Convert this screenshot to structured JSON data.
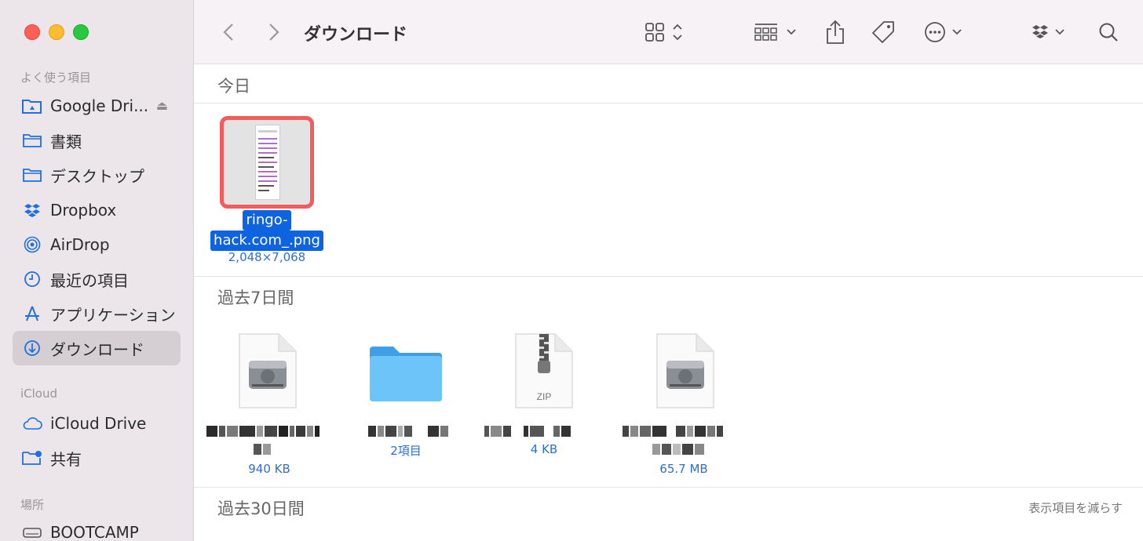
{
  "window": {
    "title": "ダウンロード"
  },
  "sidebar": {
    "favorites_header": "よく使う項目",
    "favorites": [
      {
        "label": "Google Dri...",
        "icon": "google-drive-folder-icon"
      },
      {
        "label": "書類",
        "icon": "folder-icon"
      },
      {
        "label": "デスクトップ",
        "icon": "folder-icon"
      },
      {
        "label": "Dropbox",
        "icon": "dropbox-icon"
      },
      {
        "label": "AirDrop",
        "icon": "airdrop-icon"
      },
      {
        "label": "最近の項目",
        "icon": "clock-icon"
      },
      {
        "label": "アプリケーション",
        "icon": "applications-icon"
      },
      {
        "label": "ダウンロード",
        "icon": "download-icon",
        "active": true
      }
    ],
    "icloud_header": "iCloud",
    "icloud": [
      {
        "label": "iCloud Drive",
        "icon": "cloud-icon"
      },
      {
        "label": "共有",
        "icon": "shared-folder-icon"
      }
    ],
    "locations_header": "場所",
    "locations": [
      {
        "label": "BOOTCAMP",
        "icon": "disk-icon"
      }
    ]
  },
  "groups": {
    "today": "今日",
    "last7": "過去7日間",
    "last30": "過去30日間",
    "show_less": "表示項目を減らす"
  },
  "selected_file": {
    "name_line1": "ringo-",
    "name_line2": "hack.com_.png",
    "dimensions": "2,048×7,068"
  },
  "files": [
    {
      "icon": "disk-image-icon",
      "meta": "940 KB"
    },
    {
      "icon": "folder-icon",
      "meta": "2項目"
    },
    {
      "icon": "zip-icon",
      "meta": "4 KB",
      "badge": "ZIP"
    },
    {
      "icon": "disk-image-icon",
      "meta": "65.7 MB"
    }
  ],
  "colors": {
    "accent": "#0d63e0",
    "sidebar_bg": "#ece6ea",
    "selection_outline": "#f25c5c"
  }
}
